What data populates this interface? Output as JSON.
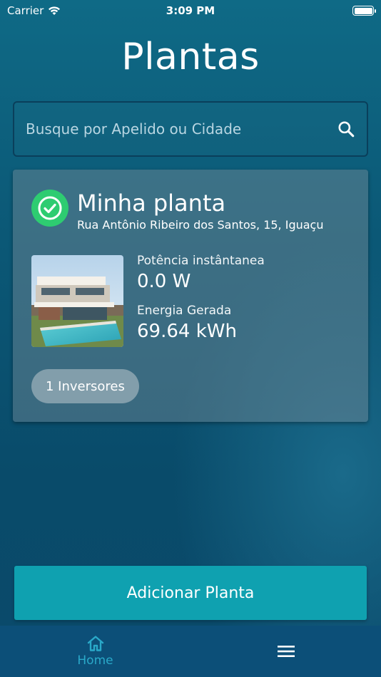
{
  "status_bar": {
    "carrier": "Carrier",
    "time": "3:09 PM"
  },
  "page": {
    "title": "Plantas"
  },
  "search": {
    "placeholder": "Busque por Apelido ou Cidade",
    "icon": "search-icon"
  },
  "plant_card": {
    "status_icon": "check-circle-icon",
    "name": "Minha planta",
    "address": "Rua Antônio Ribeiro dos Santos, 15, Iguaçu",
    "power_label": "Potência instântanea",
    "power_value": "0.0 W",
    "energy_label": "Energia Gerada",
    "energy_value": "69.64 kWh",
    "inverters_label": "1 Inversores"
  },
  "actions": {
    "add_plant_label": "Adicionar Planta"
  },
  "tab_bar": {
    "home_label": "Home",
    "home_icon": "home-icon",
    "menu_icon": "menu-icon"
  },
  "colors": {
    "accent": "#0fa1b0",
    "success": "#2ecc71",
    "tab_active": "#2aa9c9",
    "tab_bar_bg": "#0c4f78"
  }
}
